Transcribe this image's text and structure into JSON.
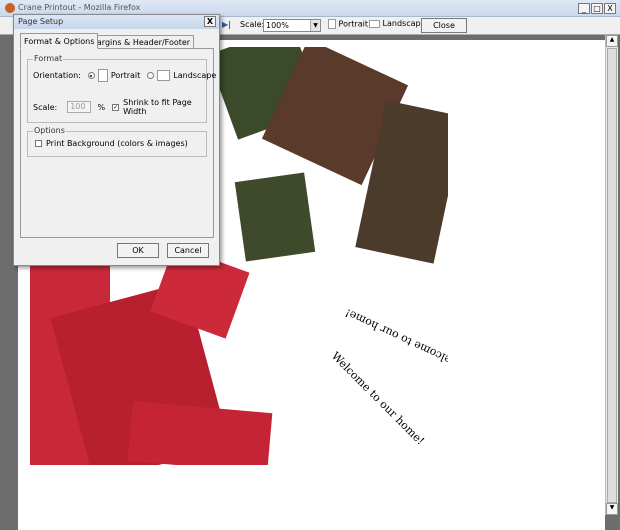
{
  "window": {
    "title": "Crane Printout - Mozilla Firefox",
    "controls": [
      "_",
      "□",
      "X"
    ]
  },
  "toolbar": {
    "scale_label": "Scale:",
    "scale_value": "100%",
    "portrait": "Portrait",
    "landscape": "Landscape",
    "close": "Close"
  },
  "preview": {
    "text1": "Welcome to our home!",
    "text2": "Welcome to our home!"
  },
  "dialog": {
    "title": "Page Setup",
    "close": "X",
    "tabs": [
      "Format & Options",
      "Margins & Header/Footer"
    ],
    "active_tab": 0,
    "format_legend": "Format",
    "orientation_label": "Orientation:",
    "portrait": "Portrait",
    "landscape": "Landscape",
    "orientation_selected": "Portrait",
    "scale_label": "Scale:",
    "scale_value": "100",
    "percent": "%",
    "shrink_label": "Shrink to fit Page Width",
    "shrink_checked": true,
    "options_legend": "Options",
    "print_bg_label": "Print Background (colors & images)",
    "print_bg_checked": false,
    "ok": "OK",
    "cancel": "Cancel"
  }
}
